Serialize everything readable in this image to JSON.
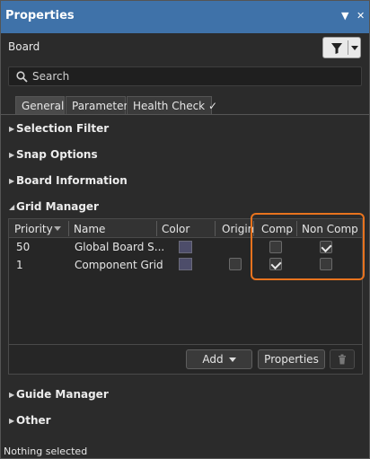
{
  "panel": {
    "title": "Properties",
    "dropdown_icon": "triangle-down",
    "close_icon": "x"
  },
  "header": {
    "object_label": "Board"
  },
  "search": {
    "placeholder": "Search"
  },
  "tabs": [
    {
      "label": "General"
    },
    {
      "label": "Parameters"
    },
    {
      "label": "Health Check ✓"
    }
  ],
  "sections": {
    "selection_filter": "Selection Filter",
    "snap_options": "Snap Options",
    "board_information": "Board Information",
    "grid_manager": "Grid Manager",
    "guide_manager": "Guide Manager",
    "other": "Other"
  },
  "grid_manager": {
    "columns": [
      "Priority",
      "Name",
      "Color",
      "Origin",
      "Comp",
      "Non Comp"
    ],
    "rows": [
      {
        "priority": "50",
        "name": "Global Board S...",
        "origin": null,
        "comp": false,
        "non_comp": true
      },
      {
        "priority": "1",
        "name": "Component Grid",
        "origin": false,
        "comp": true,
        "non_comp": false
      }
    ],
    "add_label": "Add",
    "properties_label": "Properties"
  },
  "status": {
    "text": "Nothing selected"
  },
  "colors": {
    "title_bar": "#3f72a9",
    "highlight": "#e8731e",
    "background": "#2b2b2b"
  }
}
